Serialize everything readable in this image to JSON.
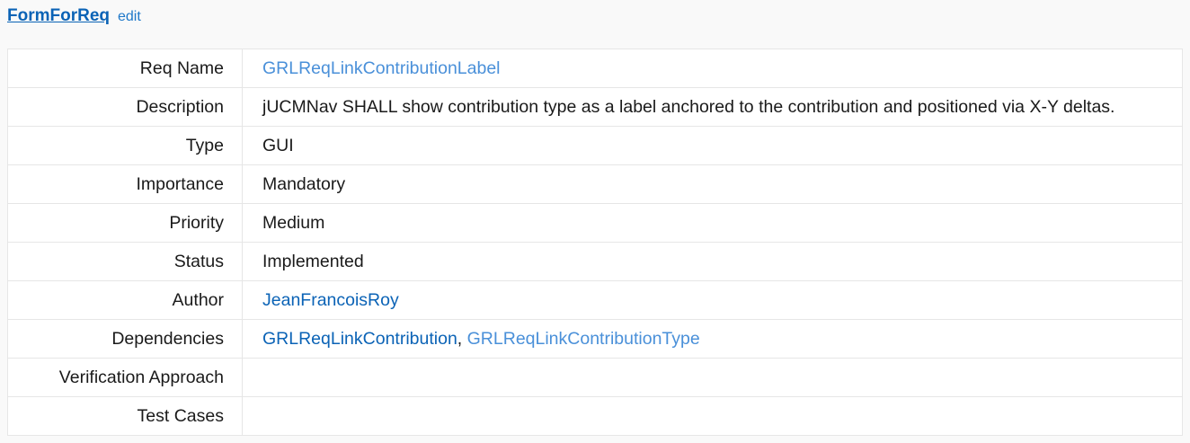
{
  "header": {
    "form_link": "FormForReq",
    "edit_link": "edit"
  },
  "rows": [
    {
      "label": "Req Name",
      "value": "GRLReqLinkContributionLabel"
    },
    {
      "label": "Description",
      "value": "jUCMNav SHALL show contribution type as a label anchored to the contribution and positioned via X-Y deltas."
    },
    {
      "label": "Type",
      "value": "GUI"
    },
    {
      "label": "Importance",
      "value": "Mandatory"
    },
    {
      "label": "Priority",
      "value": "Medium"
    },
    {
      "label": "Status",
      "value": "Implemented"
    },
    {
      "label": "Author",
      "value": "JeanFrancoisRoy"
    },
    {
      "label": "Dependencies",
      "links": [
        "GRLReqLinkContribution",
        "GRLReqLinkContributionType"
      ],
      "separator": ", "
    },
    {
      "label": "Verification Approach",
      "value": ""
    },
    {
      "label": "Test Cases",
      "value": ""
    }
  ],
  "colors": {
    "link_existing": "#0b63b6",
    "link_light": "#4a90d9",
    "background": "#f9f9f9",
    "table_border": "#e6e6e6"
  }
}
